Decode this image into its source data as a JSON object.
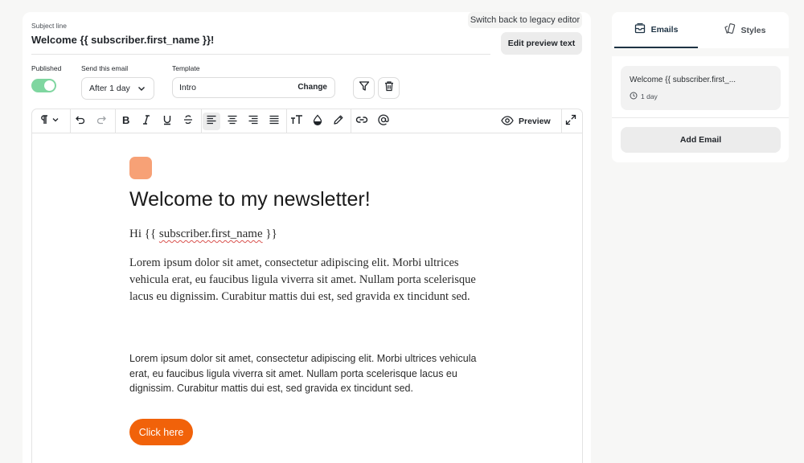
{
  "header": {
    "legacy_link": "Switch back to legacy editor",
    "subject_label": "Subject line",
    "subject_value": "Welcome {{ subscriber.first_name }}!",
    "edit_preview_label": "Edit preview text"
  },
  "settings": {
    "published_label": "Published",
    "published": true,
    "send_label": "Send this email",
    "send_value": "After 1 day",
    "template_label": "Template",
    "template_value": "Intro",
    "template_change": "Change"
  },
  "toolbar": {
    "preview_label": "Preview"
  },
  "content": {
    "heading": "Welcome to my newsletter!",
    "greeting_hi": "Hi {{",
    "greeting_var": "subscriber.first_name",
    "greeting_end": "}}",
    "para1": "Lorem ipsum dolor sit amet, consectetur adipiscing elit. Morbi ultrices vehicula erat, eu faucibus ligula viverra sit amet. Nullam porta scelerisque lacus eu dignissim. Curabitur mattis dui est, sed gravida ex tincidunt sed.",
    "para2": "Lorem ipsum dolor sit amet, consectetur adipiscing elit. Morbi ultrices vehicula erat, eu faucibus ligula viverra sit amet. Nullam porta scelerisque lacus eu dignissim. Curabitur mattis dui est, sed gravida ex tincidunt sed.",
    "cta_label": "Click here"
  },
  "sidebar": {
    "tab_emails": "Emails",
    "tab_styles": "Styles",
    "email_title": "Welcome {{ subscriber.first_...",
    "email_delay": "1 day",
    "add_email": "Add Email"
  },
  "colors": {
    "accent": "#f1620a",
    "toggle_on": "#7fd6a0",
    "logo_block": "#f7a176",
    "tab_active": "#1e3344"
  }
}
